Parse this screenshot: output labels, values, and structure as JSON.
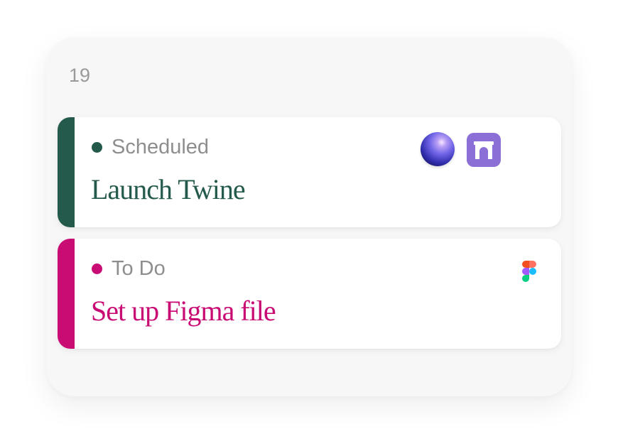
{
  "date_label": "19",
  "cards": [
    {
      "status": "Scheduled",
      "title": "Launch Twine",
      "accent_color": "#245a4c",
      "icons": [
        "sphere-icon",
        "twine-app-icon"
      ]
    },
    {
      "status": "To Do",
      "title": "Set up Figma file",
      "accent_color": "#c90b74",
      "icons": [
        "figma-icon"
      ]
    }
  ],
  "colors": {
    "scheduled_accent": "#245a4c",
    "todo_accent": "#c90b74",
    "status_text": "#8e8e8e",
    "panel_background": "#f7f7f7",
    "app_icon_purple": "#8b6fd6"
  }
}
